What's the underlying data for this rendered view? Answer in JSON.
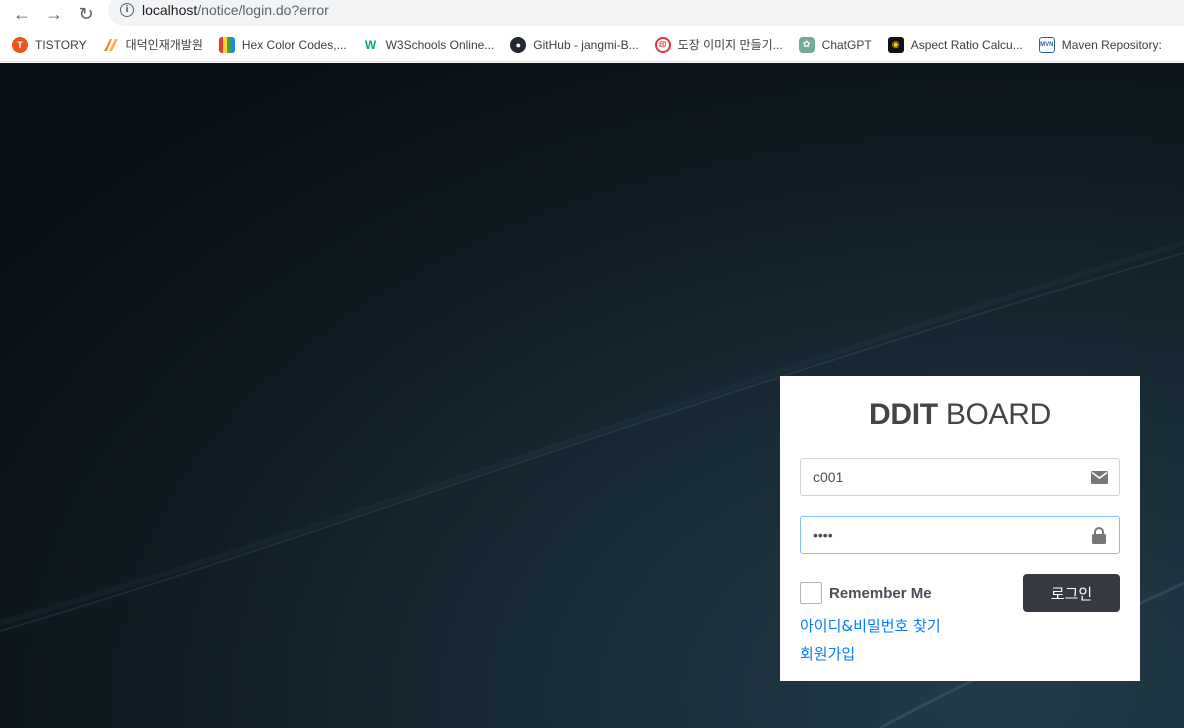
{
  "browser": {
    "url_host": "localhost",
    "url_path": "/notice/login.do?error",
    "bookmarks": [
      {
        "label": "TISTORY",
        "icon": "tistory-icon",
        "color": "#eb531f"
      },
      {
        "label": "대덕인재개발원",
        "icon": "ddit-icon",
        "color": "#f08c2e"
      },
      {
        "label": "Hex Color Codes,...",
        "icon": "hex-color-icon",
        "color": "#2a5bd7"
      },
      {
        "label": "W3Schools Online...",
        "icon": "w3schools-icon",
        "color": "#04aa6d"
      },
      {
        "label": "GitHub - jangmi-B...",
        "icon": "github-icon",
        "color": "#24292f"
      },
      {
        "label": "도장 이미지 만들기...",
        "icon": "stamp-icon",
        "color": "#d9363e"
      },
      {
        "label": "ChatGPT",
        "icon": "chatgpt-icon",
        "color": "#74aa9c"
      },
      {
        "label": "Aspect Ratio Calcu...",
        "icon": "aspect-ratio-icon",
        "color": "#f5d000"
      },
      {
        "label": "Maven Repository:",
        "icon": "maven-icon",
        "color": "#2c5ea8"
      }
    ]
  },
  "login": {
    "brand_bold": "DDIT",
    "brand_light": " BOARD",
    "username_value": "c001",
    "password_value": "••••",
    "remember_label": "Remember Me",
    "submit_label": "로그인",
    "find_link": "아이디&비밀번호 찾기",
    "signup_link": "회원가입"
  }
}
